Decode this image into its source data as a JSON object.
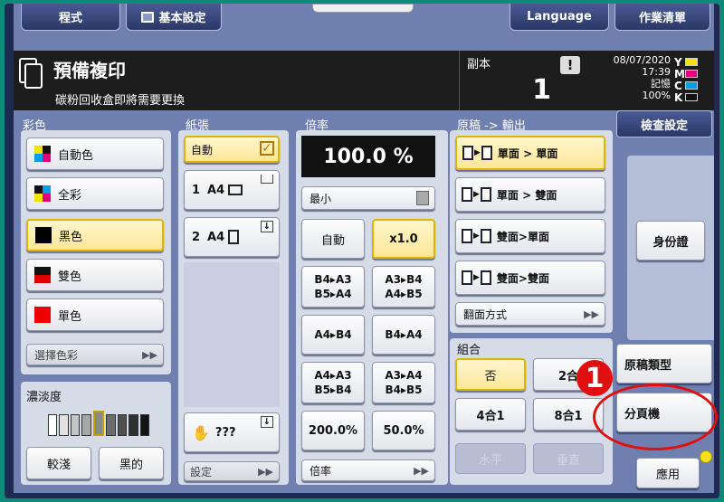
{
  "top": {
    "program": "程式",
    "basic_settings": "基本設定",
    "language": "Language",
    "job_list": "作業清單"
  },
  "status": {
    "title": "預備複印",
    "message": "碳粉回收盒即將需要更換",
    "copies_label": "副本",
    "copies_value": "1",
    "date": "08/07/2020",
    "time": "17:39",
    "memory_label": "記憶",
    "memory_value": "100%",
    "toner": [
      {
        "letter": "Y",
        "color": "#f2e400"
      },
      {
        "letter": "M",
        "color": "#e4007f"
      },
      {
        "letter": "C",
        "color": "#00a0e9"
      },
      {
        "letter": "K",
        "color": "#111111"
      }
    ],
    "warning_icon": "exclamation-icon"
  },
  "color": {
    "label": "彩色",
    "items": [
      "自動色",
      "全彩",
      "黑色",
      "雙色",
      "單色"
    ],
    "select": "選擇色彩",
    "selected_index": 2
  },
  "density": {
    "label": "濃淡度",
    "lighter": "較淺",
    "darker": "黑的",
    "level": 5,
    "steps": 9
  },
  "paper": {
    "label": "紙張",
    "auto": "自動",
    "tray1_num": "1",
    "tray1_size": "A4",
    "tray2_num": "2",
    "tray2_size": "A4",
    "bypass": "???",
    "settings": "設定"
  },
  "zoom": {
    "label": "倍率",
    "value": "100.0 %",
    "min": "最小",
    "auto": "自動",
    "x1": "x1.0",
    "b4a3_a": "B4▸A3",
    "b5a4_a": "B5▸A4",
    "a3b4_a": "A3▸B4",
    "a4b5_a": "A4▸B5",
    "a4b4": "A4▸B4",
    "b4a4": "B4▸A4",
    "a4a3_b": "A4▸A3",
    "b5b4_b": "B5▸B4",
    "a3a4_b": "A3▸A4",
    "b4b5_b": "B4▸B5",
    "p200": "200.0%",
    "p50": "50.0%",
    "more": "倍率"
  },
  "duplex": {
    "label": "原稿 -> 輸出",
    "items": [
      "單面 > 單面",
      "單面 > 雙面",
      "雙面>單面",
      "雙面>雙面"
    ],
    "flip": "翻面方式"
  },
  "combine": {
    "label": "組合",
    "off": "否",
    "two": "2合",
    "four": "4合1",
    "eight": "8合1",
    "horizontal": "水平",
    "vertical": "垂直"
  },
  "right": {
    "check": "檢查設定",
    "id_card": "身份證",
    "original_type": "原稿類型",
    "sort": "分頁機",
    "apply": "應用"
  },
  "annotation": {
    "number": "1",
    "color": "#e01010"
  }
}
